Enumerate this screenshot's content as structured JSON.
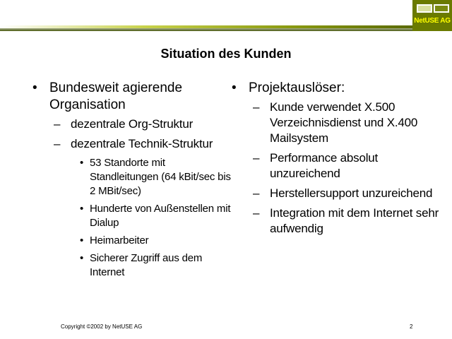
{
  "header": {
    "logo_text": "NetUSE AG"
  },
  "title": "Situation des Kunden",
  "left": {
    "items": [
      {
        "text": "Bundesweit agierende Organisation",
        "children": [
          {
            "text": "dezentrale Org-Struktur"
          },
          {
            "text": "dezentrale Technik-Struktur"
          }
        ]
      }
    ],
    "sub3": [
      "53 Standorte mit Standleitungen (64 kBit/sec bis 2 MBit/sec)",
      "Hunderte von Außenstellen mit Dialup",
      "Heimarbeiter",
      "Sicherer Zugriff aus dem Internet"
    ]
  },
  "right": {
    "heading": "Projektauslöser:",
    "items": [
      "Kunde verwendet X.500 Verzeichnisdienst und X.400 Mailsystem",
      "Performance absolut unzureichend",
      "Herstellersupport unzureichend",
      "Integration mit dem Internet sehr aufwendig"
    ]
  },
  "footer": {
    "copyright": "Copyright ©2002 by NetUSE AG",
    "page": "2"
  },
  "bullets": {
    "level1": "•",
    "level2": "–",
    "level3": "•"
  },
  "colors": {
    "logo_bg": "#6a7a00",
    "logo_text": "#ffff00",
    "header_line": "#8a9a10"
  }
}
